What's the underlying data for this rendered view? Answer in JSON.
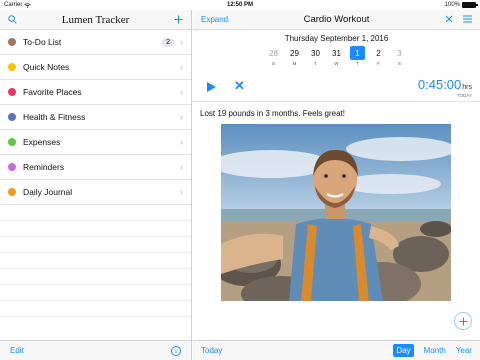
{
  "status": {
    "carrier": "Carrier",
    "time": "12:50 PM",
    "battery": "100%",
    "battery_level": 1.0
  },
  "sidebar": {
    "title": "Lumen Tracker",
    "items": [
      {
        "label": "To-Do List",
        "color": "#9b7a62",
        "badge": "2"
      },
      {
        "label": "Quick Notes",
        "color": "#f5c400",
        "badge": ""
      },
      {
        "label": "Favorite Places",
        "color": "#e8366b",
        "badge": ""
      },
      {
        "label": "Health & Fitness",
        "color": "#5a74c8",
        "badge": ""
      },
      {
        "label": "Expenses",
        "color": "#5ec93a",
        "badge": ""
      },
      {
        "label": "Reminders",
        "color": "#c569d6",
        "badge": ""
      },
      {
        "label": "Daily Journal",
        "color": "#f29a1c",
        "badge": ""
      }
    ],
    "footer": {
      "edit": "Edit",
      "info_icon": "i"
    }
  },
  "main": {
    "expand": "Expand",
    "title": "Cardio Workout",
    "date": "Thursday  September 1, 2016",
    "week": [
      {
        "num": "28",
        "label": "S"
      },
      {
        "num": "29",
        "label": "M"
      },
      {
        "num": "30",
        "label": "T"
      },
      {
        "num": "31",
        "label": "W"
      },
      {
        "num": "1",
        "label": "T"
      },
      {
        "num": "2",
        "label": "F"
      },
      {
        "num": "3",
        "label": "S"
      }
    ],
    "timer": {
      "time": "0:45:00",
      "unit": "hrs",
      "sub": "TODAY"
    },
    "note": "Lost 19 pounds in 3 months. Feels great!",
    "footer": {
      "today": "Today",
      "day": "Day",
      "month": "Month",
      "year": "Year"
    }
  },
  "colors": {
    "accent": "#1a8cff"
  }
}
